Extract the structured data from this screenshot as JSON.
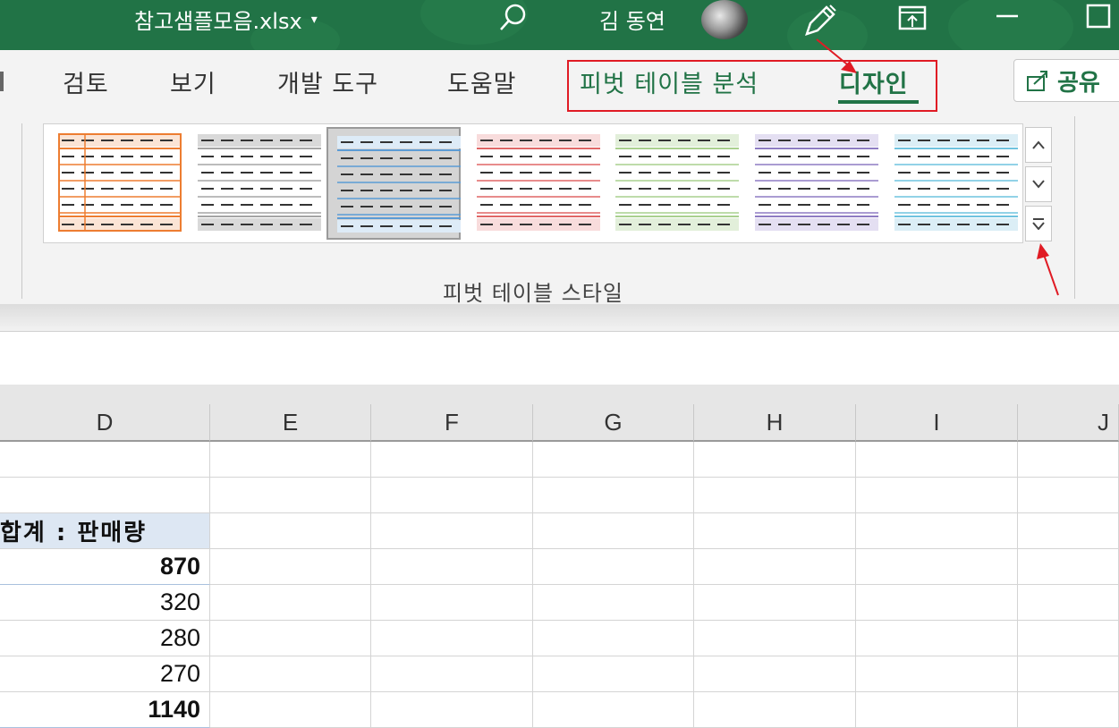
{
  "titlebar": {
    "file_name": "참고샘플모음.xlsx",
    "caret": "▾",
    "user_name": "김 동연"
  },
  "ribbon": {
    "tabs": [
      "검토",
      "보기",
      "개발 도구",
      "도움말"
    ],
    "context_tabs": [
      "피벗 테이블 분석",
      "디자인"
    ],
    "active_tab": "디자인",
    "share_label": "공유",
    "group_label": "피벗 테이블 스타일",
    "styles": [
      {
        "color": "#ed7d31",
        "tint": "#fbe4d5",
        "selected": false
      },
      {
        "color": "#a5a5a5",
        "tint": "#d9d9d9",
        "selected": false
      },
      {
        "color": "#5b9bd5",
        "tint": "#ddebf7",
        "selected": true
      },
      {
        "color": "#e06666",
        "tint": "#f8dcdc",
        "selected": false
      },
      {
        "color": "#a9d08e",
        "tint": "#e2efda",
        "selected": false
      },
      {
        "color": "#8e7cc3",
        "tint": "#e4dff2",
        "selected": false
      },
      {
        "color": "#6fc3df",
        "tint": "#dbeef6",
        "selected": false
      }
    ],
    "accent": "#217346"
  },
  "sheet": {
    "columns": [
      "D",
      "E",
      "F",
      "G",
      "H",
      "I",
      "J"
    ],
    "column_d": [
      {
        "text": "",
        "kind": "empty"
      },
      {
        "text": "",
        "kind": "empty"
      },
      {
        "text": "합계 : 판매량",
        "kind": "header"
      },
      {
        "text": "870",
        "kind": "bold"
      },
      {
        "text": "320",
        "kind": "value"
      },
      {
        "text": "280",
        "kind": "value"
      },
      {
        "text": "270",
        "kind": "value"
      },
      {
        "text": "1140",
        "kind": "bold"
      }
    ]
  },
  "annotations": {
    "highlight_color": "#e01b24"
  }
}
